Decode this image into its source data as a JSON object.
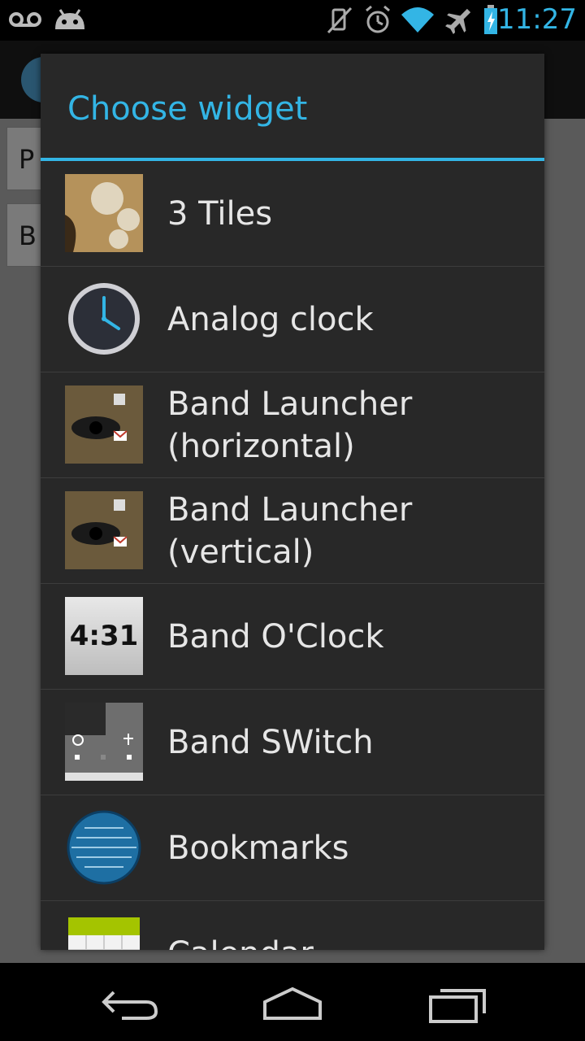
{
  "status_bar": {
    "time": "11:27",
    "left_icons": [
      "voicemail-icon",
      "android-notification-icon"
    ],
    "right_icons": [
      "vibrate-mute-icon",
      "alarm-icon",
      "wifi-icon",
      "airplane-icon",
      "battery-charging-icon"
    ],
    "accent": "#33b5e5"
  },
  "background_app": {
    "button_1_label": "P",
    "button_2_label": "B"
  },
  "dialog": {
    "title": "Choose widget",
    "accent": "#33b5e5",
    "items": [
      {
        "label": "3 Tiles",
        "icon": "three-tiles-widget-icon"
      },
      {
        "label": "Analog clock",
        "icon": "analog-clock-icon"
      },
      {
        "label": "Band Launcher\n(horizontal)",
        "icon": "band-launcher-horizontal-icon"
      },
      {
        "label": "Band Launcher\n(vertical)",
        "icon": "band-launcher-vertical-icon"
      },
      {
        "label": "Band O'Clock",
        "icon": "band-oclock-icon",
        "preview_text": "4:31"
      },
      {
        "label": "Band SWitch",
        "icon": "band-switch-icon"
      },
      {
        "label": "Bookmarks",
        "icon": "bookmarks-globe-icon"
      },
      {
        "label": "Calendar",
        "icon": "calendar-icon"
      }
    ]
  },
  "nav_bar": {
    "buttons": [
      "back-icon",
      "home-icon",
      "recent-apps-icon"
    ]
  }
}
